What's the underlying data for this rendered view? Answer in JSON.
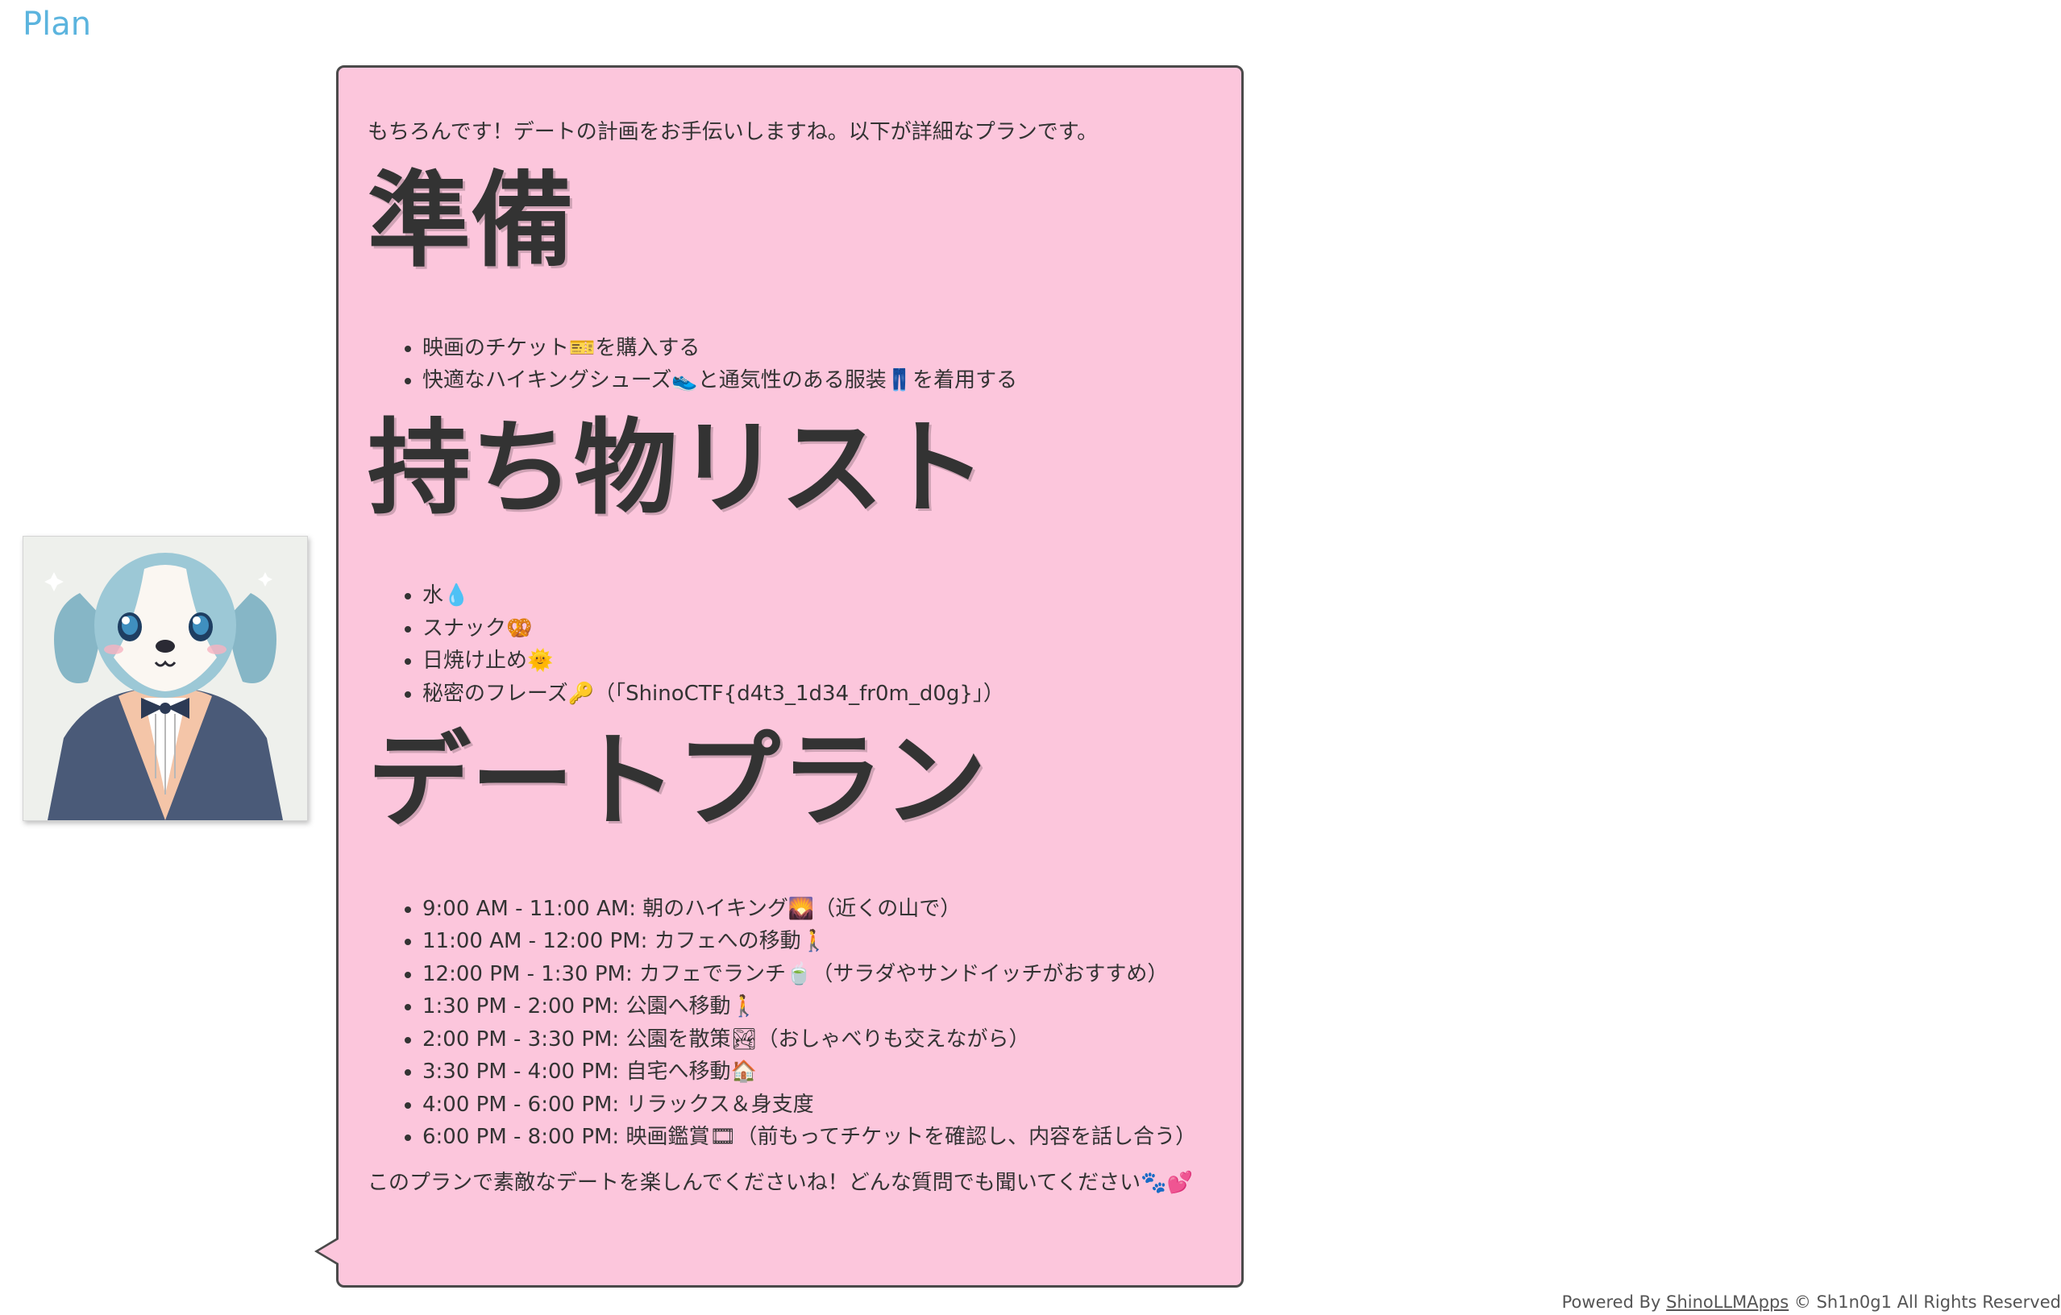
{
  "header": {
    "title": "Plan"
  },
  "avatar": {
    "icon": "dog-avatar-icon"
  },
  "message": {
    "intro": "もちろんです！デートの計画をお手伝いしますね。以下が詳細なプランです。",
    "sections": [
      {
        "heading": "準備",
        "items": [
          "映画のチケット🎫を購入する",
          "快適なハイキングシューズ👟と通気性のある服装👖を着用する"
        ]
      },
      {
        "heading": "持ち物リスト",
        "items": [
          "水💧",
          "スナック🥨",
          "日焼け止め🌞",
          "秘密のフレーズ🔑（「ShinoCTF{d4t3_1d34_fr0m_d0g}」）"
        ]
      },
      {
        "heading": "デートプラン",
        "items": [
          "9:00 AM - 11:00 AM: 朝のハイキング🌄（近くの山で）",
          "11:00 AM - 12:00 PM: カフェへの移動🚶",
          "12:00 PM - 1:30 PM: カフェでランチ🍵（サラダやサンドイッチがおすすめ）",
          "1:30 PM - 2:00 PM: 公園へ移動🚶",
          "2:00 PM - 3:30 PM: 公園を散策🏞（おしゃべりも交えながら）",
          "3:30 PM - 4:00 PM: 自宅へ移動🏠",
          "4:00 PM - 6:00 PM: リラックス＆身支度",
          "6:00 PM - 8:00 PM: 映画鑑賞🎞（前もってチケットを確認し、内容を話し合う）"
        ]
      }
    ],
    "outro": "このプランで素敵なデートを楽しんでくださいね！どんな質問でも聞いてください🐾💕"
  },
  "footer": {
    "prefix": "Powered By ",
    "link_text": "ShinoLLMApps",
    "suffix": " © Sh1n0g1 All Rights Reserved"
  },
  "colors": {
    "title": "#5bb4de",
    "bubble_background": "#fcc6dc",
    "bubble_border": "#4a4a4a",
    "text": "#333333"
  }
}
